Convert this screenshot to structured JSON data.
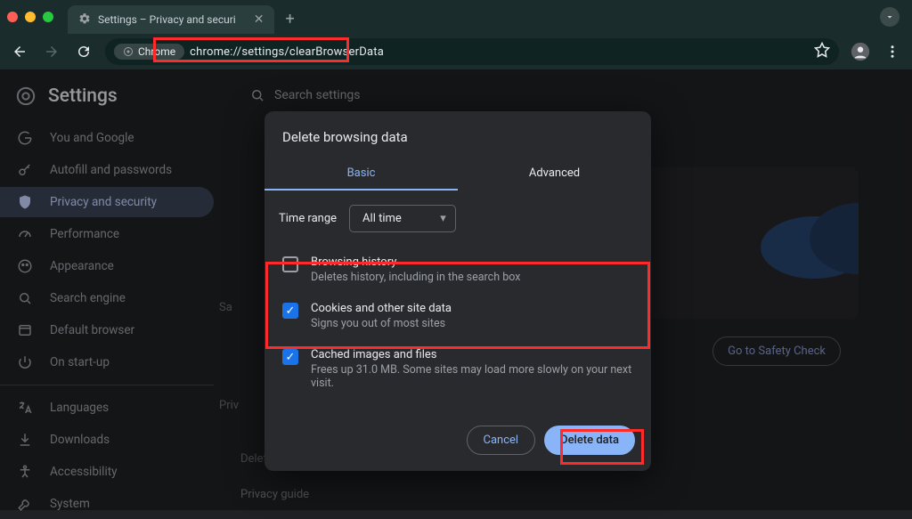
{
  "window": {
    "tab_title": "Settings – Privacy and securi",
    "url": "chrome://settings/clearBrowserData",
    "chrome_chip_label": "Chrome"
  },
  "settings": {
    "header": "Settings",
    "search_placeholder": "Search settings",
    "nav": [
      {
        "id": "you-and-google",
        "label": "You and Google"
      },
      {
        "id": "autofill",
        "label": "Autofill and passwords"
      },
      {
        "id": "privacy",
        "label": "Privacy and security",
        "active": true
      },
      {
        "id": "performance",
        "label": "Performance"
      },
      {
        "id": "appearance",
        "label": "Appearance"
      },
      {
        "id": "search-engine",
        "label": "Search engine"
      },
      {
        "id": "default-browser",
        "label": "Default browser"
      },
      {
        "id": "on-startup",
        "label": "On start-up"
      },
      {
        "id": "languages",
        "label": "Languages"
      },
      {
        "id": "downloads",
        "label": "Downloads"
      },
      {
        "id": "accessibility",
        "label": "Accessibility"
      },
      {
        "id": "system",
        "label": "System"
      }
    ]
  },
  "background": {
    "go_safety": "Go to Safety Check",
    "section_safety": "Sa",
    "section_priv": "Priv",
    "ghost_delete": "Delete history, cookies, cache and more",
    "ghost_privacy": "Privacy guide"
  },
  "dialog": {
    "title": "Delete browsing data",
    "tabs": {
      "basic": "Basic",
      "advanced": "Advanced"
    },
    "time_range_label": "Time range",
    "time_range_value": "All time",
    "items": {
      "history": {
        "title": "Browsing history",
        "sub": "Deletes history, including in the search box",
        "checked": false
      },
      "cookies": {
        "title": "Cookies and other site data",
        "sub": "Signs you out of most sites",
        "checked": true
      },
      "cache": {
        "title": "Cached images and files",
        "sub": "Frees up 31.0 MB. Some sites may load more slowly on your next visit.",
        "checked": true
      }
    },
    "actions": {
      "cancel": "Cancel",
      "delete": "Delete data"
    }
  }
}
